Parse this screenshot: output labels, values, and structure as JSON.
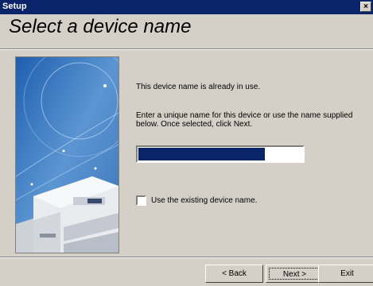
{
  "window": {
    "title": "Setup",
    "close_glyph": "×"
  },
  "page": {
    "heading": "Select a device name"
  },
  "message": {
    "line1": "This device name is already in use.",
    "line2": "Enter a unique name for this device or use the name supplied below. Once selected, click Next."
  },
  "checkbox": {
    "label": "Use the existing device name.",
    "checked": false
  },
  "buttons": {
    "back": "< Back",
    "next": "Next >",
    "exit": "Exit"
  },
  "icons": {
    "close": "close-icon",
    "printer": "printer-illustration"
  },
  "colors": {
    "titlebar": "#0a246a",
    "selection": "#0a246a",
    "panel": "#4d86c6",
    "face": "#d4d0c8"
  }
}
